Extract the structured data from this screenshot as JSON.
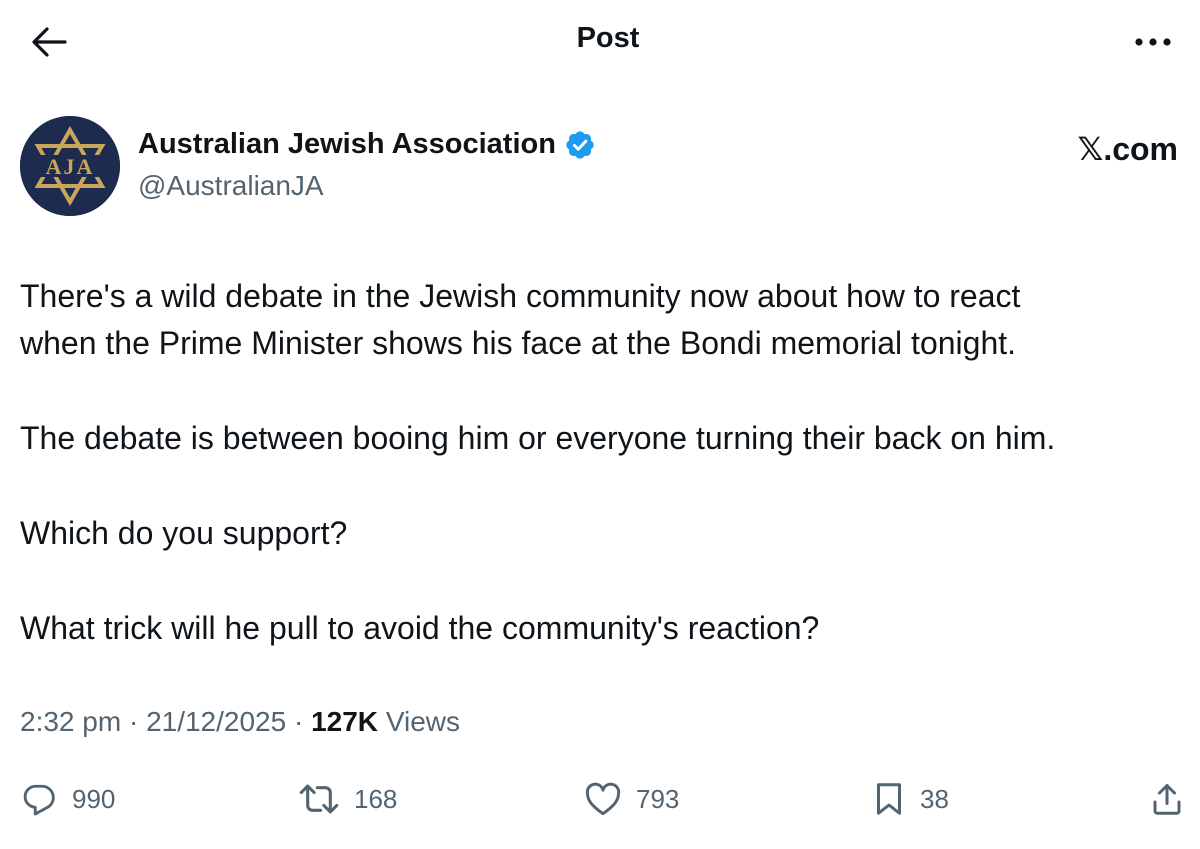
{
  "topbar": {
    "back_icon": "arrow-left-icon",
    "title": "Post",
    "more_icon": "more-horizontal-icon"
  },
  "author": {
    "name": "Australian Jewish Association",
    "handle": "@AustralianJA",
    "verified": true,
    "avatar_text": "AJA",
    "avatar_bg": "#1d2b4f",
    "avatar_gold": "#c9a659"
  },
  "source_tag": "𝕏.com",
  "post": {
    "paragraphs": [
      [
        "There's a wild debate in the Jewish community now about how to react",
        "when the Prime Minister shows his face at the Bondi memorial tonight."
      ],
      [
        "The debate is between booing him or everyone turning their back on him."
      ],
      [
        "Which do you support?"
      ],
      [
        "What trick will he pull to avoid the community's reaction?"
      ]
    ]
  },
  "meta": {
    "time": "2:32 pm",
    "separator": "·",
    "date": "21/12/2025",
    "views_count": "127K",
    "views_label": "Views"
  },
  "actions": {
    "reply_count": "990",
    "repost_count": "168",
    "like_count": "793",
    "bookmark_count": "38"
  },
  "colors": {
    "text_primary": "#0f1419",
    "text_secondary": "#536471",
    "verified_blue": "#1d9bf0"
  }
}
